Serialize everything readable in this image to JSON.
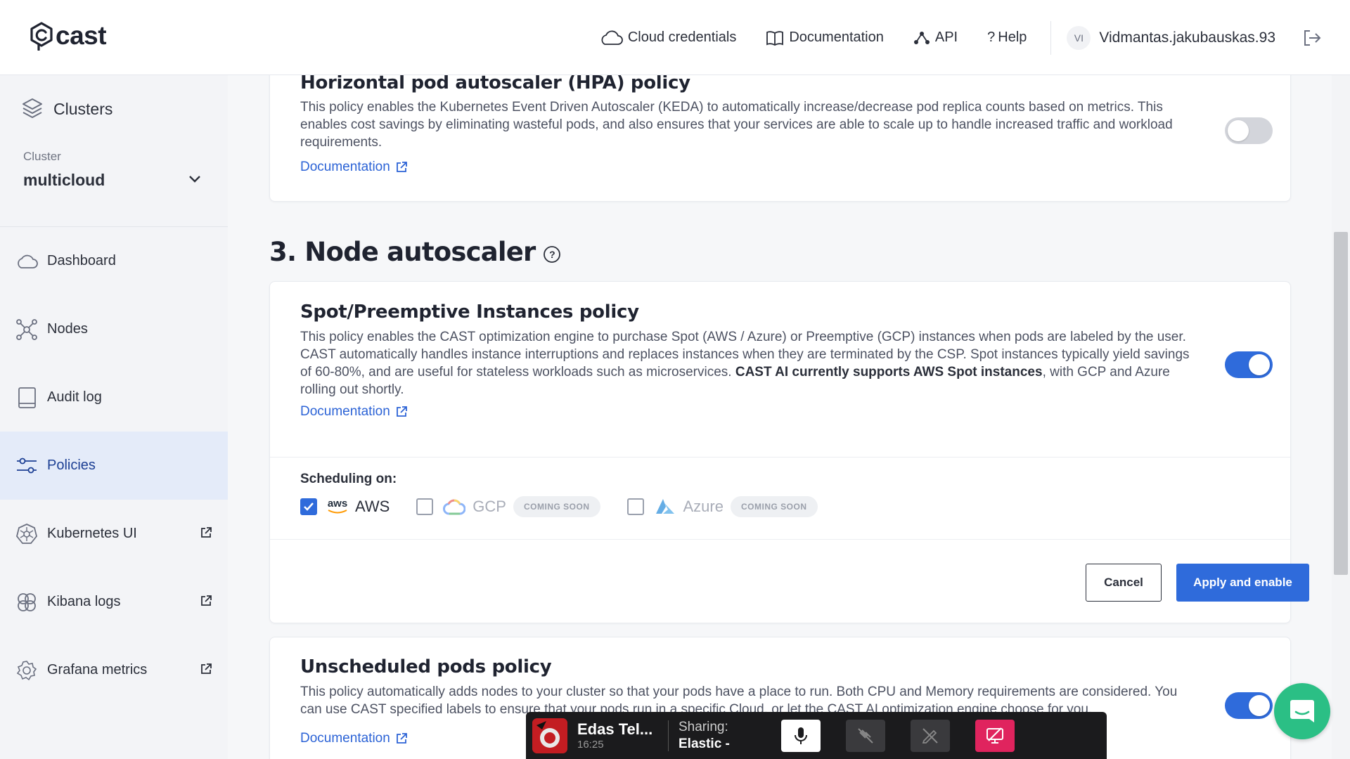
{
  "header": {
    "logo_text": "cast",
    "nav": {
      "cloud_credentials": "Cloud credentials",
      "documentation": "Documentation",
      "api": "API",
      "help": "Help"
    },
    "user": {
      "initials": "VI",
      "name": "Vidmantas.jakubauskas.93"
    }
  },
  "sidebar": {
    "section_title": "Clusters",
    "cluster_label": "Cluster",
    "cluster_name": "multicloud",
    "items": [
      {
        "label": "Dashboard",
        "icon": "cloud-icon",
        "external": false
      },
      {
        "label": "Nodes",
        "icon": "nodes-icon",
        "external": false
      },
      {
        "label": "Audit log",
        "icon": "book-icon",
        "external": false
      },
      {
        "label": "Policies",
        "icon": "sliders-icon",
        "external": false,
        "active": true
      },
      {
        "label": "Kubernetes UI",
        "icon": "kubernetes-icon",
        "external": true
      },
      {
        "label": "Kibana logs",
        "icon": "kibana-icon",
        "external": true
      },
      {
        "label": "Grafana metrics",
        "icon": "grafana-icon",
        "external": true
      }
    ]
  },
  "hpa_card": {
    "title": "Horizontal pod autoscaler (HPA) policy",
    "description": "This policy enables the Kubernetes Event Driven Autoscaler (KEDA) to automatically increase/decrease pod replica counts based on metrics. This enables cost savings by eliminating wasteful pods, and also ensures that your services are able to scale up to handle increased traffic and workload requirements.",
    "doc_link": "Documentation",
    "enabled": false
  },
  "section": {
    "title": "3. Node autoscaler"
  },
  "spot_card": {
    "title": "Spot/Preemptive Instances policy",
    "description_start": "This policy enables the CAST optimization engine to purchase Spot (AWS / Azure) or Preemptive (GCP) instances when pods are labeled by the user. CAST automatically handles instance interruptions and replaces instances when they are terminated by the CSP. Spot instances typically yield savings of 60-80%, and are useful for stateless workloads such as microservices. ",
    "description_bold": "CAST AI currently supports AWS Spot instances",
    "description_end": ", with GCP and Azure rolling out shortly.",
    "doc_link": "Documentation",
    "enabled": true,
    "scheduling_label": "Scheduling on:",
    "providers": {
      "aws": {
        "name": "AWS",
        "logo_text": "aws",
        "checked": true
      },
      "gcp": {
        "name": "GCP",
        "checked": false,
        "badge": "COMING SOON"
      },
      "azure": {
        "name": "Azure",
        "checked": false,
        "badge": "COMING SOON"
      }
    },
    "cancel_label": "Cancel",
    "apply_label": "Apply and enable"
  },
  "unscheduled_card": {
    "title": "Unscheduled pods policy",
    "description": "This policy automatically adds nodes to your cluster so that your pods have a place to run. Both CPU and Memory requirements are considered. You can use CAST specified labels to ensure that your pods run in a specific Cloud, or let the CAST AI optimization engine choose for you.",
    "doc_link": "Documentation",
    "enabled": true
  },
  "meeting_bar": {
    "name": "Edas Tel...",
    "time": "16:25",
    "sharing_label": "Sharing:",
    "sharing_value": "Elastic -"
  },
  "colors": {
    "accent": "#2f6bdb",
    "link": "#2c63d6",
    "active_sidebar": "#e4ebf9",
    "chat": "#2bbf85",
    "stop_share": "#e0245e"
  }
}
